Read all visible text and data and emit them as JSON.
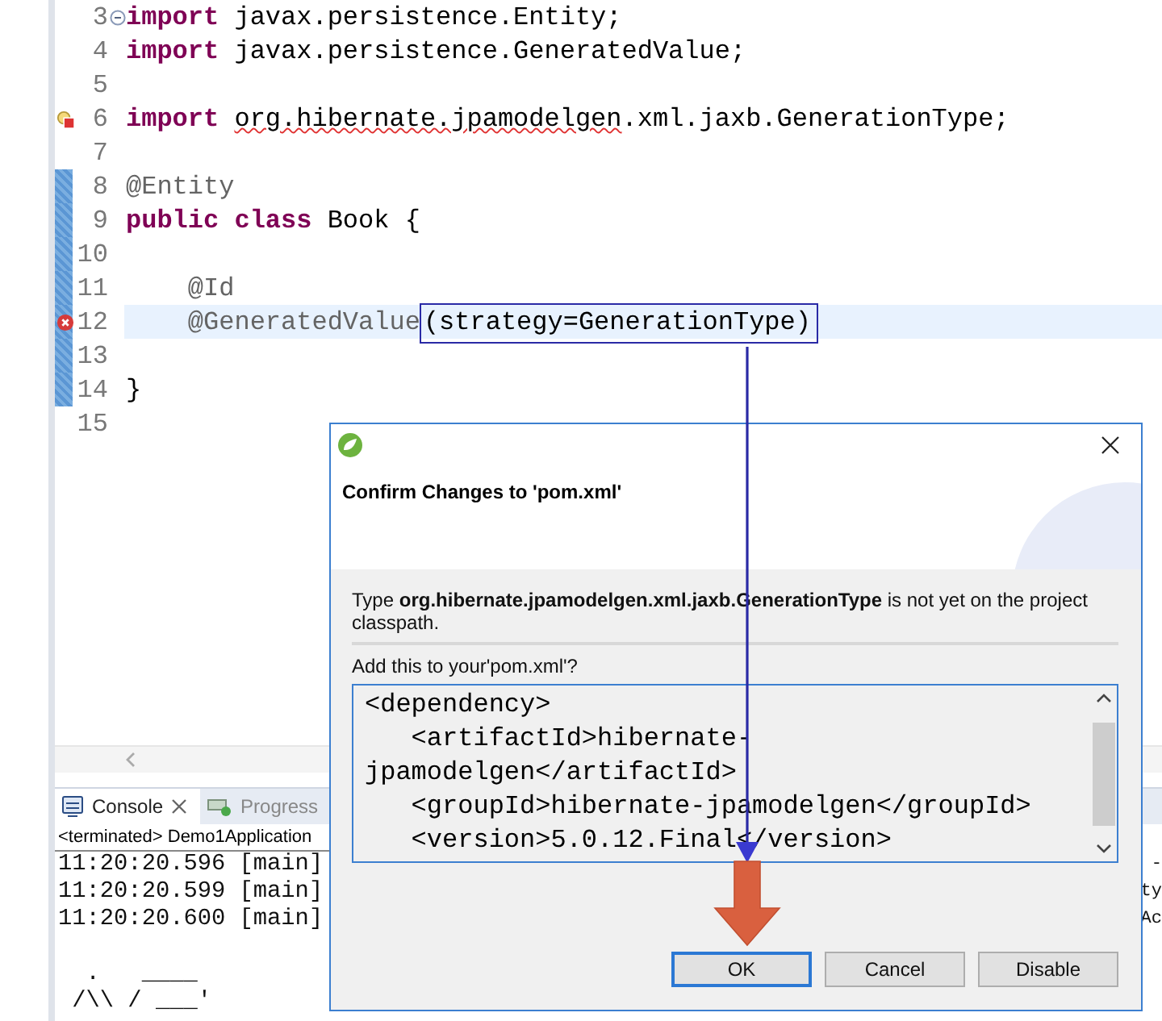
{
  "editor": {
    "lines": [
      {
        "number": "3",
        "collapsible": true,
        "error": false,
        "quick_fix": false,
        "changed": false,
        "current": false,
        "segments": [
          {
            "text": "import",
            "kind": "keyword"
          },
          {
            "text": " javax.persistence.Entity;",
            "kind": "plain"
          }
        ]
      },
      {
        "number": "4",
        "collapsible": false,
        "error": false,
        "quick_fix": false,
        "changed": false,
        "current": false,
        "segments": [
          {
            "text": "import",
            "kind": "keyword"
          },
          {
            "text": " javax.persistence.GeneratedValue;",
            "kind": "plain"
          }
        ]
      },
      {
        "number": "5",
        "collapsible": false,
        "error": false,
        "quick_fix": false,
        "changed": false,
        "current": false
      },
      {
        "number": "6",
        "collapsible": false,
        "error": true,
        "quick_fix": true,
        "changed": false,
        "current": false,
        "segments": [
          {
            "text": "import ",
            "kind": "keyword"
          },
          {
            "text": "org.hibernate.jpamodelgen",
            "kind": "error"
          },
          {
            "text": ".xml.jaxb.GenerationType;",
            "kind": "plain"
          }
        ]
      },
      {
        "number": "7",
        "collapsible": false,
        "error": false,
        "quick_fix": false,
        "changed": false,
        "current": false
      },
      {
        "number": "8",
        "collapsible": false,
        "error": false,
        "quick_fix": false,
        "changed": true,
        "current": false,
        "segments": [
          {
            "text": "@Entity",
            "kind": "annotation"
          }
        ]
      },
      {
        "number": "9",
        "collapsible": false,
        "error": false,
        "quick_fix": false,
        "changed": true,
        "current": false,
        "segments": [
          {
            "text": "public class",
            "kind": "keyword"
          },
          {
            "text": " Book {",
            "kind": "plain"
          }
        ]
      },
      {
        "number": "10",
        "collapsible": false,
        "error": false,
        "quick_fix": false,
        "changed": true,
        "current": false
      },
      {
        "number": "11",
        "collapsible": false,
        "error": false,
        "quick_fix": false,
        "changed": true,
        "current": false,
        "segments": [
          {
            "text": "    @Id",
            "kind": "annotation"
          }
        ]
      },
      {
        "number": "12",
        "collapsible": false,
        "error": true,
        "quick_fix": false,
        "changed": true,
        "current": true,
        "segments": [
          {
            "text": "    @GeneratedValue",
            "kind": "annotation"
          },
          {
            "text": "(strategy=GenerationType)",
            "kind": "plain",
            "highlighted": true
          }
        ]
      },
      {
        "number": "13",
        "collapsible": false,
        "error": false,
        "quick_fix": false,
        "changed": true,
        "current": false
      },
      {
        "number": "14",
        "collapsible": false,
        "error": false,
        "quick_fix": false,
        "changed": true,
        "current": false,
        "segments": [
          {
            "text": "}",
            "kind": "plain"
          }
        ]
      },
      {
        "number": "15",
        "collapsible": false,
        "error": false,
        "quick_fix": false,
        "changed": false,
        "current": false
      }
    ]
  },
  "console": {
    "tabs": [
      {
        "label": "Console",
        "selected": true,
        "kind": "console"
      },
      {
        "label": "Progress",
        "selected": false,
        "kind": "progress"
      }
    ],
    "process": "<terminated> Demo1Application",
    "lines": [
      {
        "text": "11:20:20.596 [main]",
        "tail": "-",
        "kind": "log"
      },
      {
        "text": "11:20:20.599 [main]",
        "tail": "ty",
        "kind": "log"
      },
      {
        "text": "11:20:20.600 [main]",
        "tail": "Ac",
        "kind": "log"
      },
      {
        "text": "  .   ____",
        "kind": "banner"
      },
      {
        "text": " /\\\\ / ___'",
        "kind": "banner"
      }
    ]
  },
  "dialog": {
    "title": "Confirm Changes to 'pom.xml'",
    "message": "Type **org.hibernate.jpamodelgen.xml.jaxb.GenerationType** is not yet on the project classpath.",
    "prompt": "Add this to your'pom.xml'?",
    "content": [
      "<dependency>",
      "   <artifactId>hibernate-",
      "jpamodelgen</artifactId>",
      "   <groupId>hibernate-jpamodelgen</groupId>",
      "   <version>5.0.12.Final</version>"
    ],
    "buttons": [
      {
        "label": "OK",
        "default": true
      },
      {
        "label": "Cancel",
        "default": false
      },
      {
        "label": "Disable",
        "default": false
      }
    ]
  }
}
